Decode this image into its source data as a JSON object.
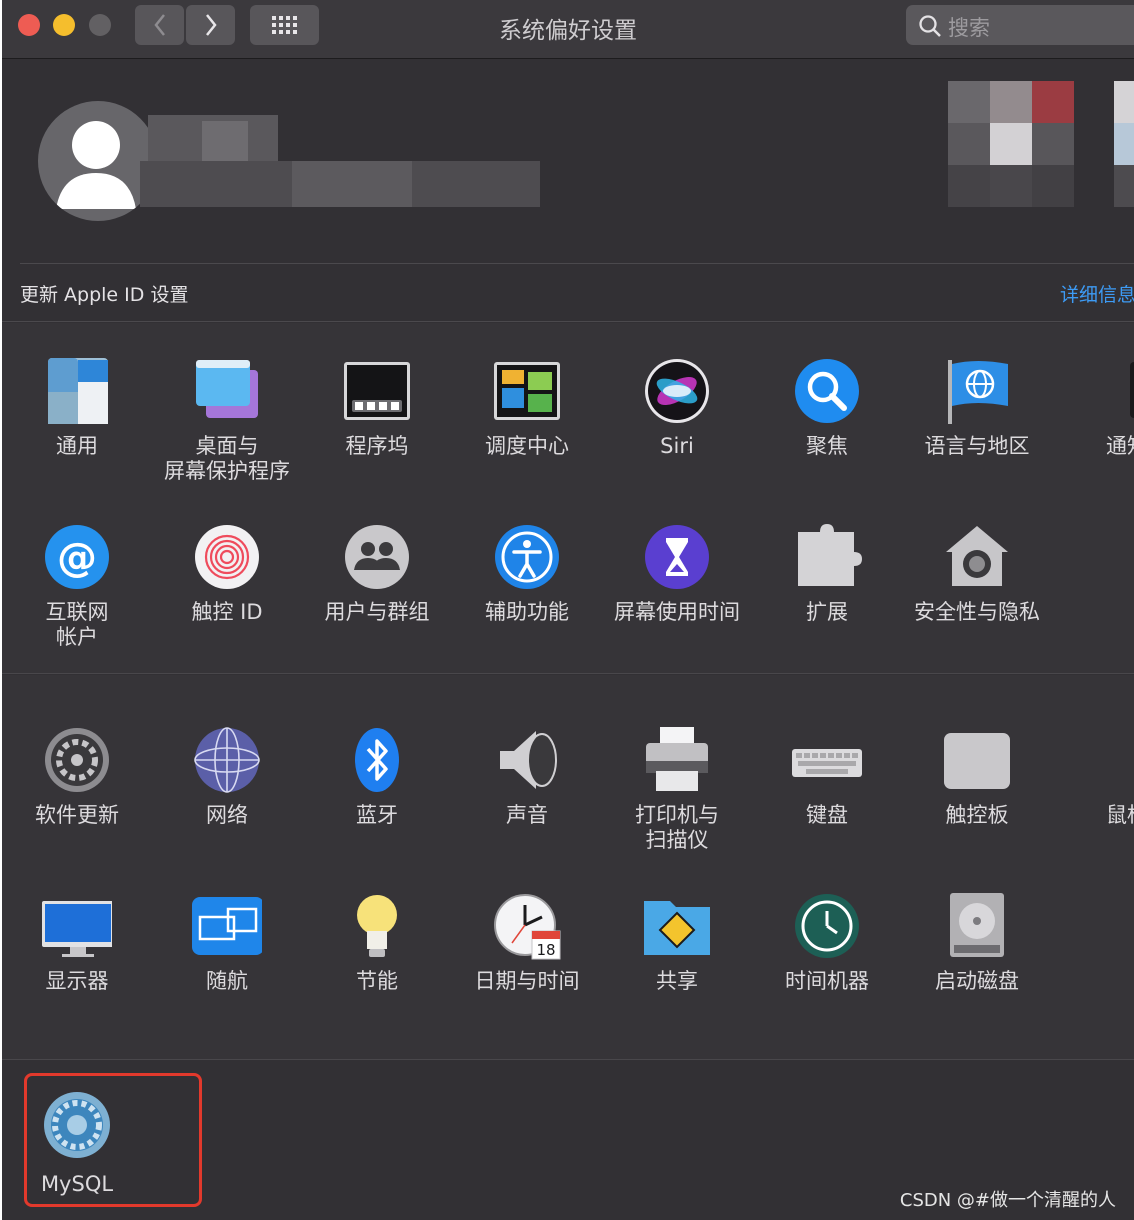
{
  "window": {
    "title": "系统偏好设置"
  },
  "toolbar": {
    "search_placeholder": "搜索"
  },
  "account": {
    "update_label": "更新 Apple ID 设置",
    "detail_link": "详细信息"
  },
  "row1": [
    "通用",
    "桌面与\n屏幕保护程序",
    "程序坞",
    "调度中心",
    "Siri",
    "聚焦",
    "语言与地区",
    "通知"
  ],
  "row2": [
    "互联网\n帐户",
    "触控 ID",
    "用户与群组",
    "辅助功能",
    "屏幕使用时间",
    "扩展",
    "安全性与隐私"
  ],
  "row3": [
    "软件更新",
    "网络",
    "蓝牙",
    "声音",
    "打印机与\n扫描仪",
    "键盘",
    "触控板",
    "鼠标"
  ],
  "row4": [
    "显示器",
    "随航",
    "节能",
    "日期与时间",
    "共享",
    "时间机器",
    "启动磁盘"
  ],
  "other": {
    "mysql": "MySQL"
  },
  "watermark": "CSDN @#做一个清醒的人",
  "icons": {
    "row1": [
      "general-icon",
      "desktop-screensaver-icon",
      "dock-icon",
      "mission-control-icon",
      "siri-icon",
      "spotlight-icon",
      "language-region-icon",
      "notifications-icon"
    ],
    "row2": [
      "internet-accounts-icon",
      "touch-id-icon",
      "users-groups-icon",
      "accessibility-icon",
      "screen-time-icon",
      "extensions-icon",
      "security-privacy-icon"
    ],
    "row3": [
      "software-update-icon",
      "network-icon",
      "bluetooth-icon",
      "sound-icon",
      "printers-scanners-icon",
      "keyboard-icon",
      "trackpad-icon",
      "mouse-icon"
    ],
    "row4": [
      "displays-icon",
      "sidecar-icon",
      "energy-saver-icon",
      "date-time-icon",
      "sharing-icon",
      "time-machine-icon",
      "startup-disk-icon"
    ]
  }
}
